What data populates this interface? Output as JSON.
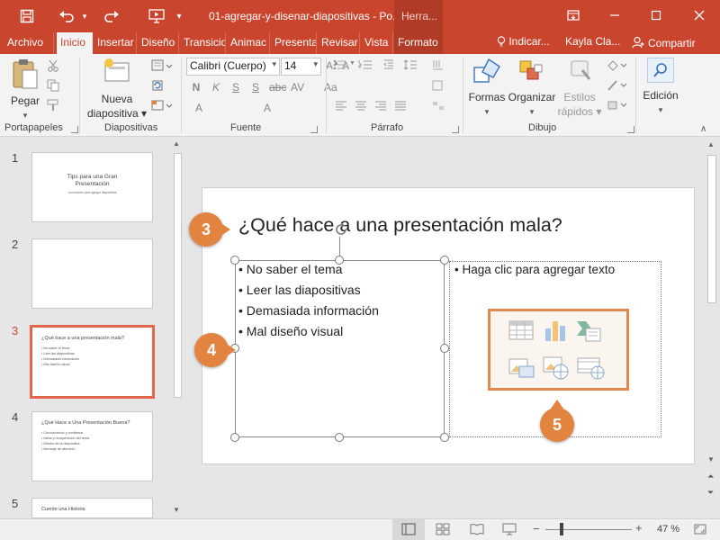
{
  "app": {
    "doc_title": "01-agregar-y-disenar-diapositivas  -  Po...",
    "contextual_tab": "Herra...",
    "colors": {
      "brand": "#c9452d",
      "accent_badge": "#e2833f",
      "selected_thumb": "#e0664e"
    }
  },
  "quick_access": {
    "icons": [
      "save-icon",
      "undo-icon",
      "redo-icon",
      "start-presentation-icon",
      "customize-icon"
    ]
  },
  "tabs": [
    {
      "label": "Archivo"
    },
    {
      "label": "Inicio",
      "active": true
    },
    {
      "label": "Insertar"
    },
    {
      "label": "Diseño"
    },
    {
      "label": "Transicio"
    },
    {
      "label": "Animac"
    },
    {
      "label": "Presenta"
    },
    {
      "label": "Revisar"
    },
    {
      "label": "Vista"
    },
    {
      "label": "Formato"
    }
  ],
  "tell_me": "Indicar...",
  "user": "Kayla Cla...",
  "share": "Compartir",
  "ribbon": {
    "clipboard": {
      "paste": "Pegar",
      "group": "Portapapeles"
    },
    "slides": {
      "new_line1": "Nueva",
      "new_line2": "diapositiva",
      "group": "Diapositivas"
    },
    "font": {
      "name": "Calibri (Cuerpo)",
      "size": "14",
      "group": "Fuente"
    },
    "paragraph": {
      "group": "Párrafo"
    },
    "drawing": {
      "shapes": "Formas",
      "arrange": "Organizar",
      "styles_line1": "Estilos",
      "styles_line2": "rápidos",
      "group": "Dibujo"
    },
    "editing": {
      "label": "Edición"
    }
  },
  "thumbnails": [
    {
      "num": "1",
      "title": "Tips para una Gran Presentación",
      "subtitle": "Un resumen para agregar diapositivas"
    },
    {
      "num": "2",
      "title": ""
    },
    {
      "num": "3",
      "title": "¿Qué hace a una presentación mala?",
      "items": [
        "No saber el tema",
        "Leer las diapositivas",
        "Demasiada información",
        "Mal diseño visual"
      ],
      "selected": true
    },
    {
      "num": "4",
      "title": "¿Qué Hace a Una Presentación Buena?",
      "items": [
        "Conocimiento y confianza",
        "Ideas y recuperación del tema",
        "Diseño de la diapositiva",
        "Mensaje de atención"
      ]
    },
    {
      "num": "5",
      "title": "Cuente una Historia"
    }
  ],
  "slide": {
    "title": "¿Qué hace a una presentación mala?",
    "bullets": [
      "No saber el tema",
      "Leer las diapositivas",
      "Demasiada información",
      "Mal diseño visual"
    ],
    "placeholder": "Haga clic para agregar texto",
    "insert_icons": [
      "table-icon",
      "chart-icon",
      "smartart-icon",
      "picture-icon",
      "online-picture-icon",
      "video-icon"
    ]
  },
  "badges": [
    "3",
    "4",
    "5"
  ],
  "status": {
    "zoom": "47 %"
  }
}
